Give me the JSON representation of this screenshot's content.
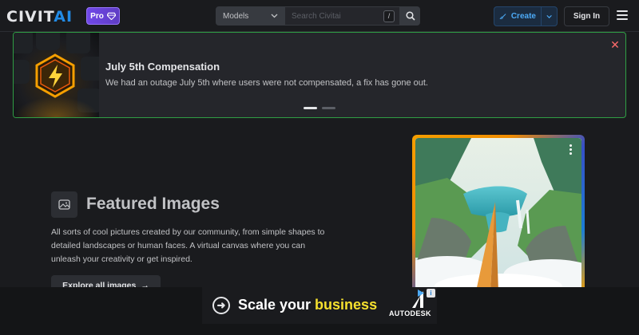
{
  "header": {
    "logo_main": "CIVIT",
    "logo_ai": "AI",
    "pro_label": "Pro",
    "search_type": "Models",
    "search_placeholder": "Search Civitai",
    "search_shortcut": "/",
    "create_label": "Create",
    "signin_label": "Sign In"
  },
  "announcement": {
    "title": "July 5th Compensation",
    "text": "We had an outage July 5th where users were not compensated, a fix has gone out.",
    "close_glyph": "✕"
  },
  "featured": {
    "title": "Featured Images",
    "description": "All sorts of cool pictures created by our community, from simple shapes to detailed landscapes or human faces. A virtual canvas where you can unleash your creativity or get inspired.",
    "button_label": "Explore all images",
    "button_arrow": "→"
  },
  "ad": {
    "arrow_glyph": "➜",
    "text_prefix": "Scale your ",
    "text_highlight": "business",
    "brand": "AUTODESK",
    "info_glyph": "i"
  },
  "colors": {
    "accent_blue": "#228be6",
    "pro_purple": "#7048e8",
    "announce_border": "#2f9e44",
    "close_red": "#ff6b6b",
    "ad_highlight": "#f5e02e"
  }
}
